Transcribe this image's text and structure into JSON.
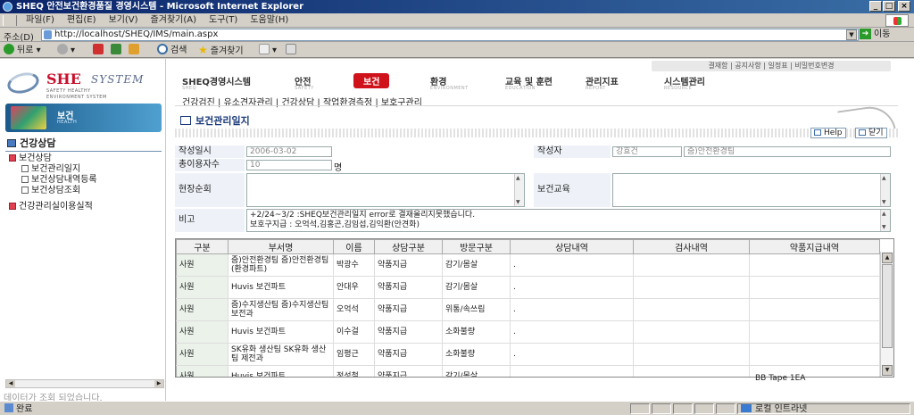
{
  "window": {
    "title": "SHEQ 안전보건환경품질 경영시스템 - Microsoft Internet Explorer"
  },
  "menu": [
    "파일(F)",
    "편집(E)",
    "보기(V)",
    "즐겨찾기(A)",
    "도구(T)",
    "도움말(H)"
  ],
  "address": {
    "label": "주소(D)",
    "url": "http://localhost/SHEQ/IMS/main.aspx",
    "go": "이동"
  },
  "toolbar": {
    "back": "뒤로",
    "search": "검색",
    "favorites": "즐겨찾기"
  },
  "logo": {
    "she": "SHE",
    "system": "SYSTEM",
    "tag1": "SAFETY  HEALTHY",
    "tag2": "ENVIRONMENT SYSTEM"
  },
  "banner": {
    "title": "보건",
    "sub": "HEALTH"
  },
  "sidebar": {
    "title": "건강상담",
    "items": [
      {
        "label": "보건상담"
      },
      {
        "label": "보건관리일지"
      },
      {
        "label": "보건상담내역등록"
      },
      {
        "label": "보건상담조회"
      },
      {
        "label": "건강관리실이용실적"
      }
    ],
    "status": "데이터가 조회 되었습니다."
  },
  "top_links": "결재함  |  공지사항  |  일정표  |  비밀번호변경",
  "nav": [
    {
      "label": "SHEQ경영시스템",
      "sub": "SHEQ"
    },
    {
      "label": "안전",
      "sub": "SAFETY"
    },
    {
      "label": "보건",
      "sub": "HEALTH"
    },
    {
      "label": "환경",
      "sub": "ENVIRONMENT"
    },
    {
      "label": "교육 및 훈련",
      "sub": "EDUCATION"
    },
    {
      "label": "관리지표",
      "sub": "REPORT"
    },
    {
      "label": "시스템관리",
      "sub": "RESOURCE"
    }
  ],
  "subnav": "건강검진  |  유소견자관리  |  건강상담  |  작업환경측정  |  보호구관리",
  "page": {
    "title": "보건관리일지",
    "help": "Help",
    "close": "닫기"
  },
  "form": {
    "date_label": "작성일시",
    "date_value": "2006-03-02",
    "author_label": "작성자",
    "author_name": "강효건",
    "author_dept": "줌)안전환경팀",
    "users_label": "총이용자수",
    "users_value": "10",
    "users_unit": "명",
    "patrol_label": "현장순회",
    "edu_label": "보건교육",
    "remark_label": "비고",
    "remark_text": "+2/24~3/2 :SHEQ보건관리일지 error로 결재올리지못했습니다.\n보호구지급 : 오억석,김홍곤,김임섭,김익환(안견화)"
  },
  "table": {
    "headers": [
      "구분",
      "부서명",
      "이름",
      "상담구분",
      "방문구분",
      "상담내역",
      "검사내역",
      "약품지급내역"
    ],
    "rows": [
      [
        "사원",
        "줌)안전환경팀 줌)안전환경팀(환경파트)",
        "박광수",
        "약품지급",
        "감기/몸살",
        ".",
        "",
        ""
      ],
      [
        "사원",
        "Huvis 보건파트",
        "안대우",
        "약품지급",
        "감기/몸살",
        ".",
        "",
        ""
      ],
      [
        "사원",
        "줌)수지생산팀 줌)수지생산팀 보전과",
        "오억석",
        "약품지급",
        "위통/속쓰림",
        ".",
        "",
        ""
      ],
      [
        "사원",
        "Huvis 보건파트",
        "이수걸",
        "약품지급",
        "소화불량",
        ".",
        "",
        ""
      ],
      [
        "사원",
        "SK유화 생산팀 SK유화 생산팀 제전과",
        "임평근",
        "약품지급",
        "소화불량",
        ".",
        "",
        ""
      ],
      [
        "사원",
        "Huvis 보건파트",
        "정성철",
        "약품지급",
        "감기/몸살",
        ".",
        "",
        ""
      ]
    ],
    "overflow_text": "BB Tape 1EA"
  },
  "statusbar": {
    "done": "완료",
    "zone": "로컬 인트라넷"
  }
}
